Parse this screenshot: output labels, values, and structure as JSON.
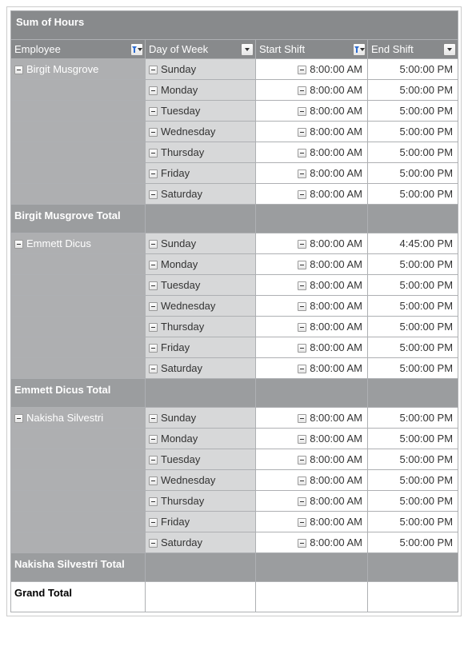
{
  "title": "Sum of Hours",
  "headers": {
    "employee": "Employee",
    "day": "Day of Week",
    "start": "Start Shift",
    "end": "End Shift"
  },
  "groups": [
    {
      "name": "Birgit Musgrove",
      "total_caption": "Birgit Musgrove Total",
      "rows": [
        {
          "day": "Sunday",
          "start": "8:00:00 AM",
          "end": "5:00:00 PM"
        },
        {
          "day": "Monday",
          "start": "8:00:00 AM",
          "end": "5:00:00 PM"
        },
        {
          "day": "Tuesday",
          "start": "8:00:00 AM",
          "end": "5:00:00 PM"
        },
        {
          "day": "Wednesday",
          "start": "8:00:00 AM",
          "end": "5:00:00 PM"
        },
        {
          "day": "Thursday",
          "start": "8:00:00 AM",
          "end": "5:00:00 PM"
        },
        {
          "day": "Friday",
          "start": "8:00:00 AM",
          "end": "5:00:00 PM"
        },
        {
          "day": "Saturday",
          "start": "8:00:00 AM",
          "end": "5:00:00 PM"
        }
      ]
    },
    {
      "name": "Emmett Dicus",
      "total_caption": "Emmett Dicus Total",
      "rows": [
        {
          "day": "Sunday",
          "start": "8:00:00 AM",
          "end": "4:45:00 PM"
        },
        {
          "day": "Monday",
          "start": "8:00:00 AM",
          "end": "5:00:00 PM"
        },
        {
          "day": "Tuesday",
          "start": "8:00:00 AM",
          "end": "5:00:00 PM"
        },
        {
          "day": "Wednesday",
          "start": "8:00:00 AM",
          "end": "5:00:00 PM"
        },
        {
          "day": "Thursday",
          "start": "8:00:00 AM",
          "end": "5:00:00 PM"
        },
        {
          "day": "Friday",
          "start": "8:00:00 AM",
          "end": "5:00:00 PM"
        },
        {
          "day": "Saturday",
          "start": "8:00:00 AM",
          "end": "5:00:00 PM"
        }
      ]
    },
    {
      "name": "Nakisha Silvestri",
      "total_caption": "Nakisha Silvestri Total",
      "rows": [
        {
          "day": "Sunday",
          "start": "8:00:00 AM",
          "end": "5:00:00 PM"
        },
        {
          "day": "Monday",
          "start": "8:00:00 AM",
          "end": "5:00:00 PM"
        },
        {
          "day": "Tuesday",
          "start": "8:00:00 AM",
          "end": "5:00:00 PM"
        },
        {
          "day": "Wednesday",
          "start": "8:00:00 AM",
          "end": "5:00:00 PM"
        },
        {
          "day": "Thursday",
          "start": "8:00:00 AM",
          "end": "5:00:00 PM"
        },
        {
          "day": "Friday",
          "start": "8:00:00 AM",
          "end": "5:00:00 PM"
        },
        {
          "day": "Saturday",
          "start": "8:00:00 AM",
          "end": "5:00:00 PM"
        }
      ]
    }
  ],
  "grand_total_caption": "Grand Total"
}
